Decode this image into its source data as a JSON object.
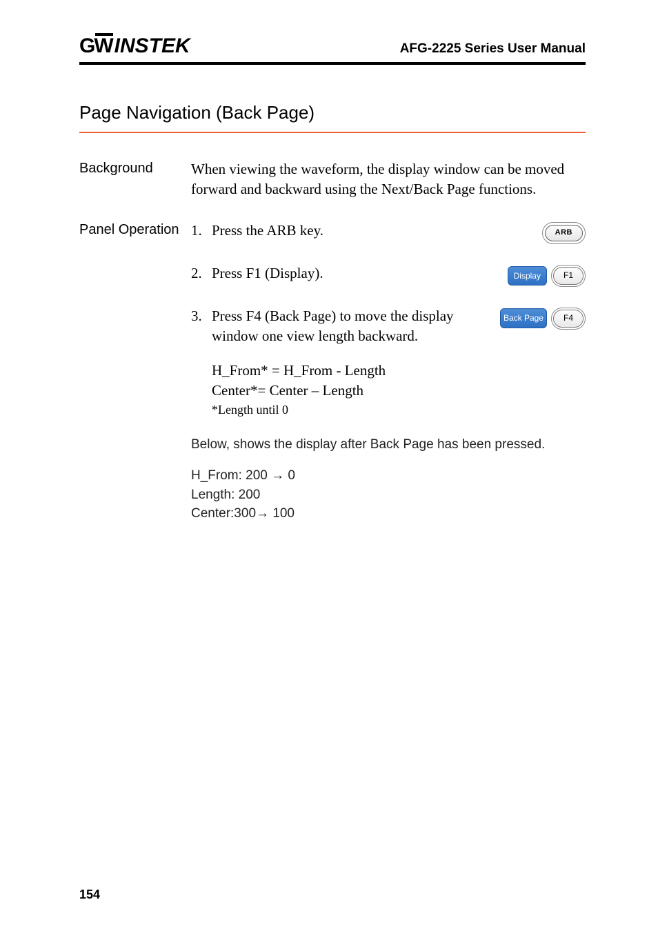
{
  "header": {
    "logo_text": "GWINSTEK",
    "doc_title": "AFG-2225 Series User Manual"
  },
  "section": {
    "title": "Page Navigation (Back Page)"
  },
  "background": {
    "label": "Background",
    "text": "When viewing the waveform, the display window can be moved forward and backward using the Next/Back Page functions."
  },
  "panel": {
    "label": "Panel Operation",
    "steps": [
      {
        "num": "1.",
        "text": "Press the ARB key.",
        "hw_btn": "ARB"
      },
      {
        "num": "2.",
        "text": "Press F1 (Display).",
        "soft_btn": "Display",
        "f_btn": "F1"
      },
      {
        "num": "3.",
        "text": "Press F4 (Back Page) to move the display window one view length backward.",
        "soft_btn": "Back Page",
        "f_btn": "F4"
      }
    ],
    "formula": {
      "line1": "H_From* = H_From - Length",
      "line2": "Center*= Center – Length",
      "note": "*Length until 0"
    },
    "below_text": "Below, shows the display after Back Page has been pressed.",
    "result": {
      "line1": "H_From: 200 → 0",
      "line2": "Length: 200",
      "line3": "Center:300→ 100"
    }
  },
  "page_number": "154"
}
